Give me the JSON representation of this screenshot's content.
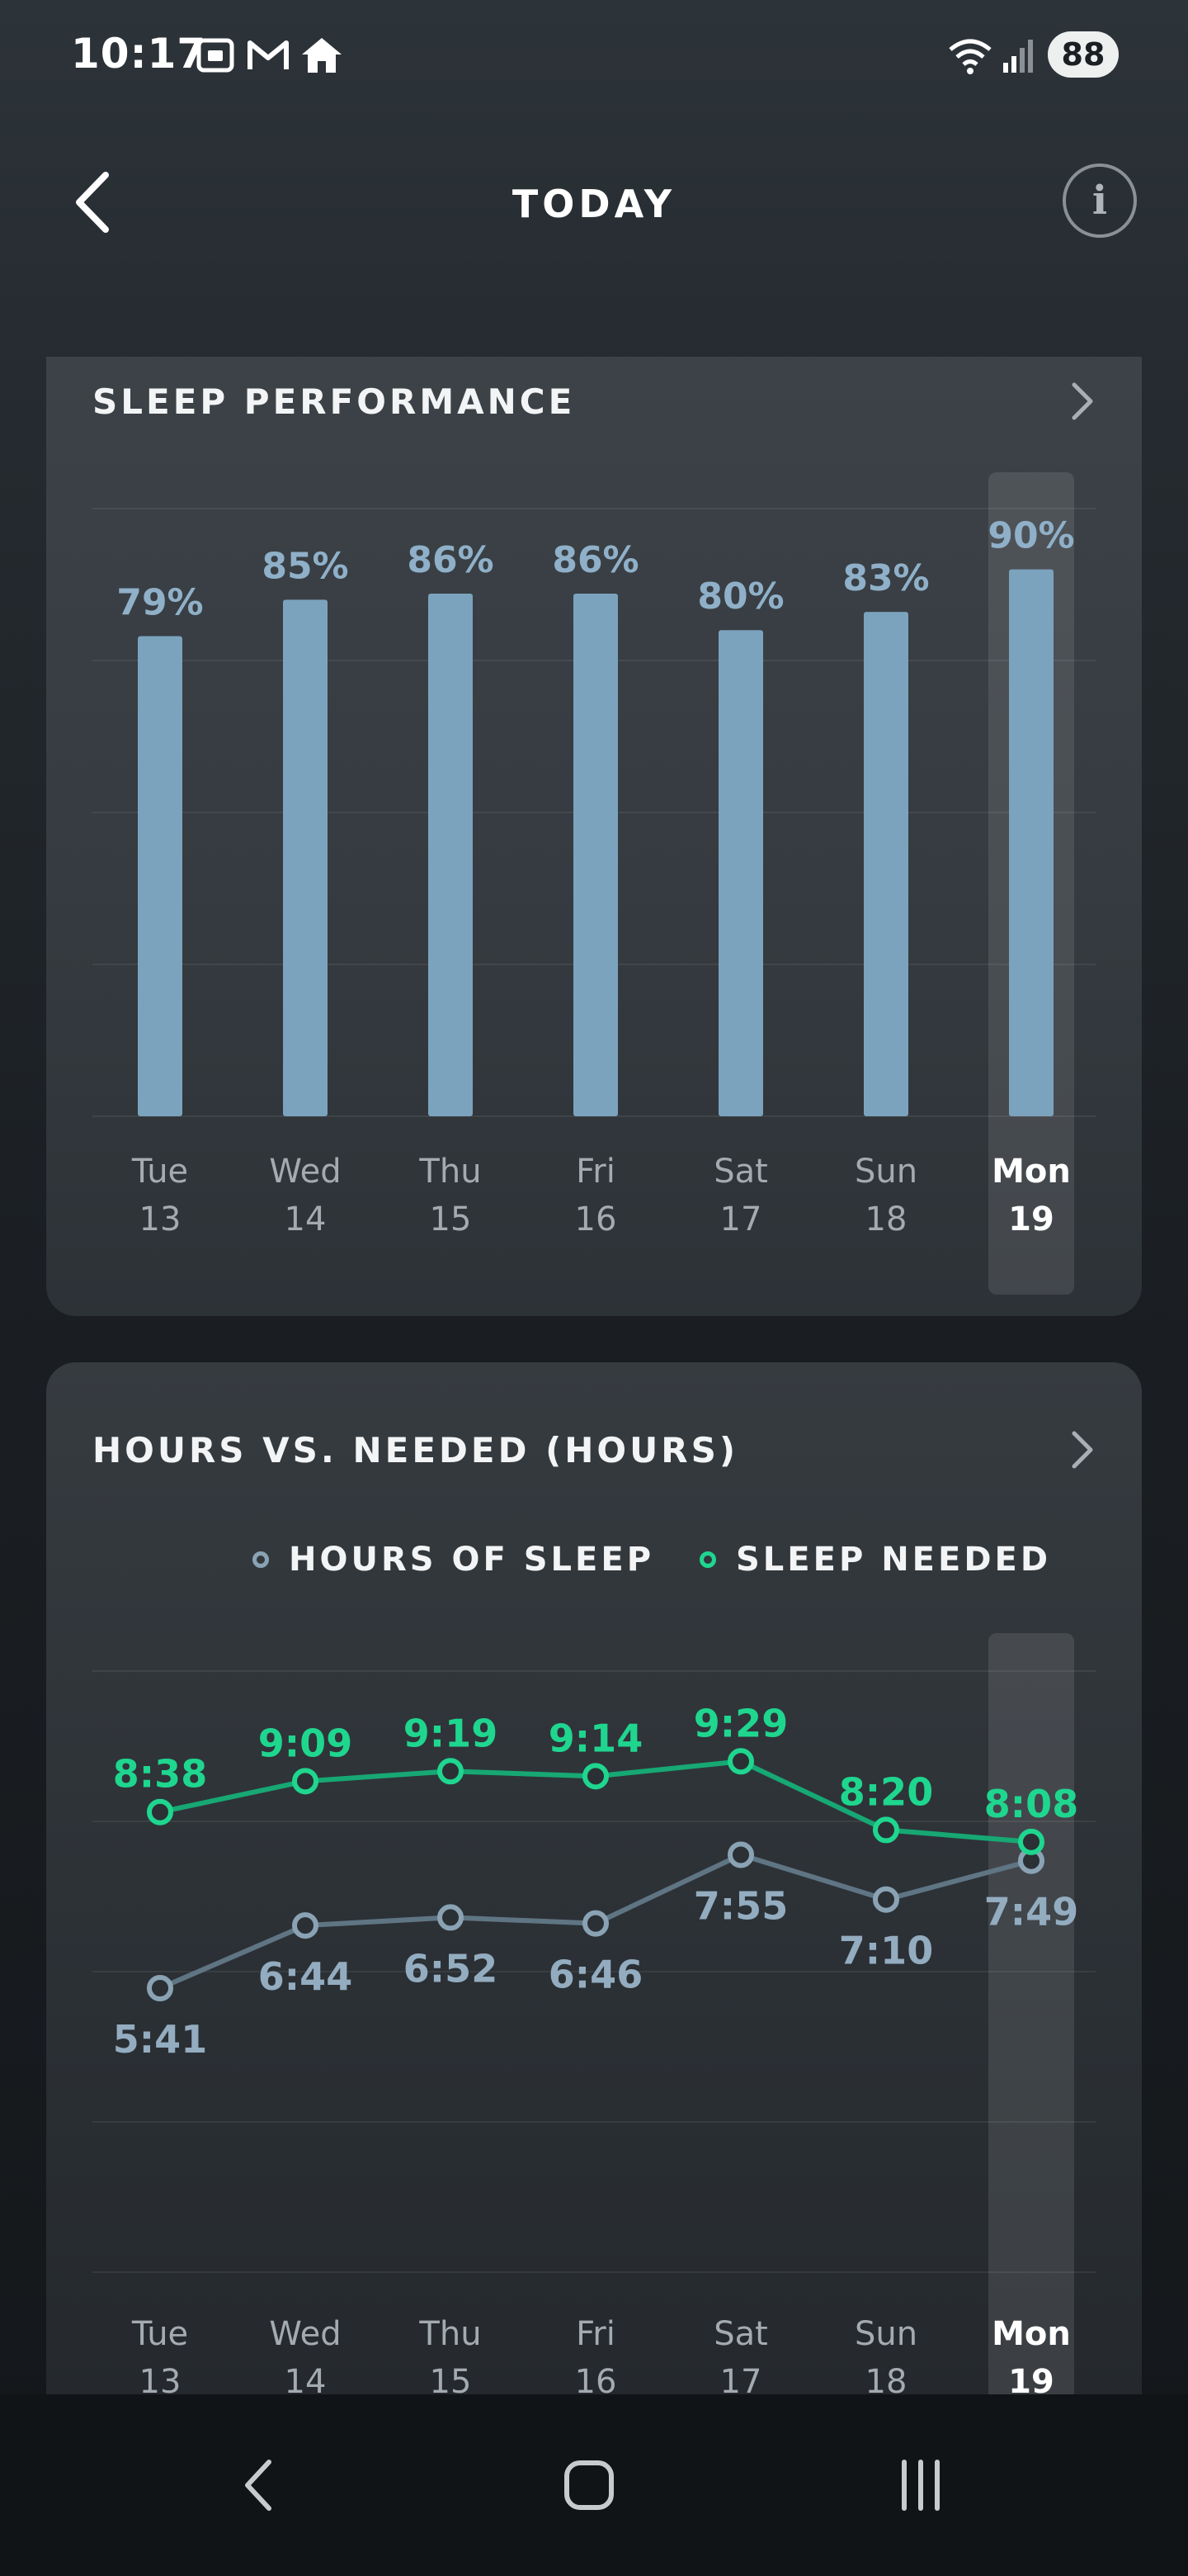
{
  "status_bar": {
    "time": "10:17",
    "battery": "88",
    "icons": [
      "screenshot-icon",
      "gmail-icon",
      "home-icon",
      "wifi-icon",
      "signal-icon"
    ]
  },
  "header": {
    "title": "TODAY"
  },
  "sleep_performance": {
    "title": "SLEEP PERFORMANCE",
    "chart_data": {
      "type": "bar",
      "categories": [
        "Tue 13",
        "Wed 14",
        "Thu 15",
        "Fri 16",
        "Sat 17",
        "Sun 18",
        "Mon 19"
      ],
      "days": [
        "Tue",
        "Wed",
        "Thu",
        "Fri",
        "Sat",
        "Sun",
        "Mon"
      ],
      "dates": [
        "13",
        "14",
        "15",
        "16",
        "17",
        "18",
        "19"
      ],
      "values": [
        79,
        85,
        86,
        86,
        80,
        83,
        90
      ],
      "labels": [
        "79%",
        "85%",
        "86%",
        "86%",
        "80%",
        "83%",
        "90%"
      ],
      "highlighted_index": 6,
      "bar_color": "#7ba3be",
      "grid": true
    }
  },
  "hours_vs_needed": {
    "title": "HOURS VS. NEEDED (HOURS)",
    "legend": [
      {
        "label": "HOURS OF SLEEP",
        "color": "#8aa3b4"
      },
      {
        "label": "SLEEP NEEDED",
        "color": "#1fd68f"
      }
    ],
    "chart_data": {
      "type": "line",
      "categories": [
        "Tue 13",
        "Wed 14",
        "Thu 15",
        "Fri 16",
        "Sat 17",
        "Sun 18",
        "Mon 19"
      ],
      "days": [
        "Tue",
        "Wed",
        "Thu",
        "Fri",
        "Sat",
        "Sun",
        "Mon"
      ],
      "dates": [
        "13",
        "14",
        "15",
        "16",
        "17",
        "18",
        "19"
      ],
      "highlighted_index": 6,
      "series": [
        {
          "name": "HOURS OF SLEEP",
          "color": "#8aa3b4",
          "values": [
            5.683,
            6.733,
            6.867,
            6.767,
            7.917,
            7.167,
            7.817
          ],
          "labels": [
            "5:41",
            "6:44",
            "6:52",
            "6:46",
            "7:55",
            "7:10",
            "7:49"
          ]
        },
        {
          "name": "SLEEP NEEDED",
          "color": "#1fd68f",
          "values": [
            8.633,
            9.15,
            9.317,
            9.233,
            9.483,
            8.333,
            8.133
          ],
          "labels": [
            "8:38",
            "9:09",
            "9:19",
            "9:14",
            "9:29",
            "8:20",
            "8:08"
          ]
        }
      ]
    }
  }
}
